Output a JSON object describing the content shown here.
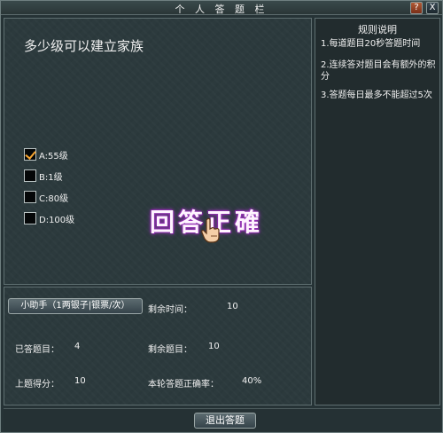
{
  "window": {
    "title": "个 人 答 题 栏",
    "help_label": "?",
    "close_label": "X"
  },
  "question": {
    "text": "多少级可以建立家族",
    "options": [
      {
        "label": "A:55级",
        "checked": true
      },
      {
        "label": "B:1级",
        "checked": false
      },
      {
        "label": "C:80级",
        "checked": false
      },
      {
        "label": "D:100级",
        "checked": false
      }
    ],
    "feedback": "回答正確"
  },
  "rules": {
    "title": "规则说明",
    "items": [
      "1.每道题目20秒答题时间",
      "2.连续答对题目会有额外的积分",
      "3.答题每日最多不能超过5次"
    ]
  },
  "stats": {
    "helper_button": "小助手（1两银子|银票/次）",
    "time_left_label": "剩余时间：",
    "time_left_value": "10",
    "answered_label": "已答题目：",
    "answered_value": "4",
    "remaining_label": "剩余题目：",
    "remaining_value": "10",
    "last_score_label": "上题得分：",
    "last_score_value": "10",
    "accuracy_label": "本轮答题正确率：",
    "accuracy_value": "40%"
  },
  "footer": {
    "exit_button": "退出答题"
  },
  "colors": {
    "check_accent": "#f7a531",
    "feedback_glow": "#a03fbf"
  }
}
